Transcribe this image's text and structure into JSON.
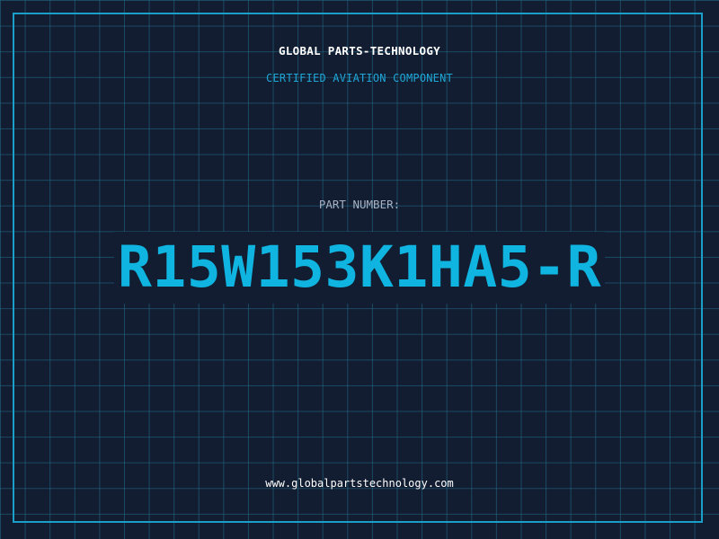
{
  "header": {
    "company": "GLOBAL PARTS-TECHNOLOGY",
    "tagline": "CERTIFIED AVIATION COMPONENT"
  },
  "part": {
    "label": "PART NUMBER:",
    "number": "R15W153K1HA5-R"
  },
  "footer": {
    "website": "www.globalpartstechnology.com"
  },
  "colors": {
    "background": "#121d31",
    "grid": "#236e8c",
    "frame": "#1aa0c8",
    "accent": "#0fb4e0",
    "title_text": "#ffffff",
    "label_text": "#a7b3c4"
  }
}
